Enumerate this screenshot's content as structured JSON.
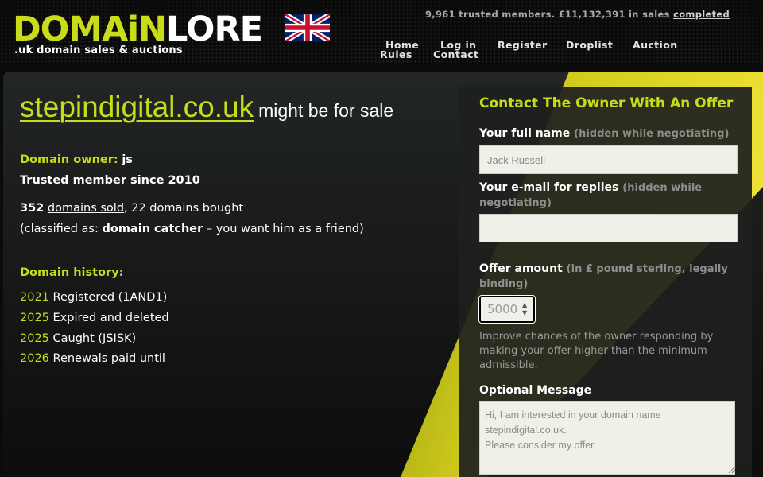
{
  "header": {
    "logo_part1": "DOMAiN",
    "logo_part2": "LORE",
    "tagline": ".uk domain sales & auctions",
    "stats_text": "9,961 trusted members. £11,132,391 in sales ",
    "stats_link": "completed",
    "nav": {
      "home": "Home",
      "login": "Log in",
      "register": "Register",
      "droplist": "Droplist",
      "auction": "Auction",
      "rules": "Rules",
      "contact": "Contact"
    }
  },
  "domain": {
    "name": "stepindigital.co.uk",
    "for_sale_text": "might be for sale"
  },
  "owner": {
    "label": "Domain owner:",
    "name": "js",
    "member_since": "Trusted member since 2010",
    "sold_count": "352",
    "sold_link": "domains sold",
    "bought_text": ", 22 domains bought",
    "class_prefix": "(classified as: ",
    "class_name": "domain catcher",
    "class_suffix": " – you want him as a friend)"
  },
  "history": {
    "label": "Domain history:",
    "events": [
      {
        "year": "2021",
        "text": " Registered (1AND1)"
      },
      {
        "year": "2025",
        "text": " Expired and deleted"
      },
      {
        "year": "2025",
        "text": " Caught (JSISK)"
      },
      {
        "year": "2026",
        "text": " Renewals paid until"
      }
    ]
  },
  "form": {
    "title": "Contact The Owner With An Offer",
    "name_label": "Your full name",
    "name_hint": "(hidden while negotiating)",
    "name_placeholder": "Jack Russell",
    "email_label": "Your e-mail for replies",
    "email_hint": "(hidden while negotiating)",
    "email_value": "",
    "offer_label": "Offer amount",
    "offer_hint": "(in £ pound sterling, legally binding)",
    "offer_placeholder": "5000",
    "offer_note": "Improve chances of the owner responding by making your offer higher than the minimum admissible.",
    "message_label": "Optional Message",
    "message_placeholder": "Hi, I am interested in your domain name stepindigital.co.uk.\nPlease consider my offer."
  },
  "colors": {
    "accent": "#c8dc19",
    "background": "#0b0b0b",
    "input_bg": "#f0efe8"
  }
}
